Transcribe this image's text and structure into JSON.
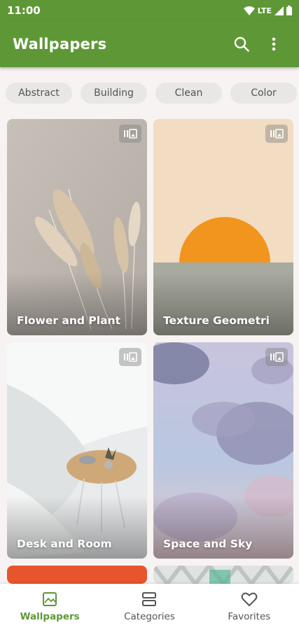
{
  "status": {
    "time": "11:00",
    "network": "LTE"
  },
  "app_bar": {
    "title": "Wallpapers"
  },
  "chips": [
    "Abstract",
    "Building",
    "Clean",
    "Color"
  ],
  "cards": [
    {
      "title": "Flower and Plant"
    },
    {
      "title": "Texture Geometri"
    },
    {
      "title": "Desk and Room"
    },
    {
      "title": "Space and Sky"
    }
  ],
  "nav": [
    {
      "label": "Wallpapers",
      "icon": "image-icon",
      "active": true
    },
    {
      "label": "Categories",
      "icon": "categories-icon",
      "active": false
    },
    {
      "label": "Favorites",
      "icon": "heart-icon",
      "active": false
    }
  ],
  "colors": {
    "primary": "#5e9836",
    "background": "#f7f3f2",
    "chip": "#e8e7e6"
  }
}
